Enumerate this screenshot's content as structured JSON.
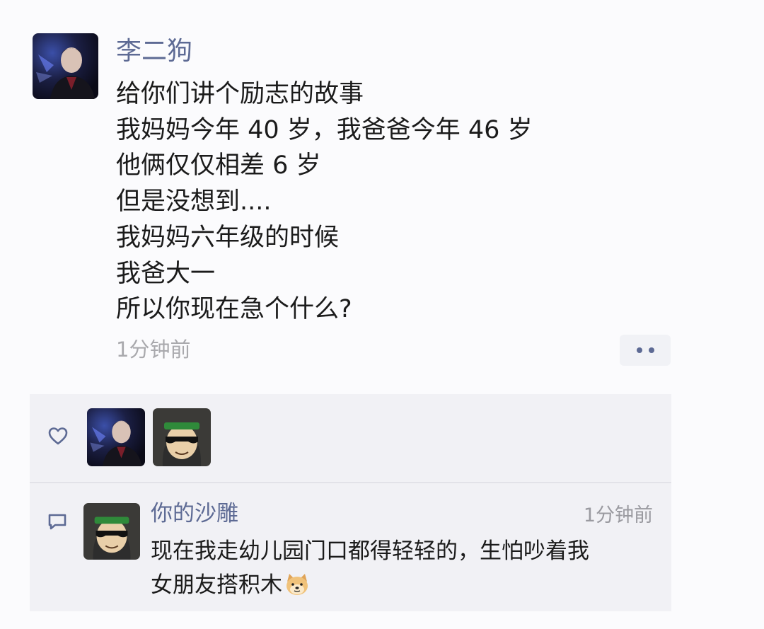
{
  "post": {
    "author": "李二狗",
    "lines": [
      "给你们讲个励志的故事",
      "我妈妈今年 40 岁，我爸爸今年 46 岁",
      "他俩仅仅相差 6 岁",
      "但是没想到....",
      "我妈妈六年级的时候",
      "我爸大一",
      "所以你现在急个什么?"
    ],
    "time": "1分钟前"
  },
  "likes": {
    "icon": "heart-icon",
    "avatars": [
      "avatar-dark-portrait",
      "avatar-cartoon-sunglasses"
    ]
  },
  "comment": {
    "icon": "comment-icon",
    "author": "你的沙雕",
    "time": "1分钟前",
    "text_line1": "现在我走幼儿园门口都得轻轻的，生怕吵着我",
    "text_line2": "女朋友搭积木",
    "emoji": "doge-emoji"
  },
  "colors": {
    "name": "#5d6a94",
    "text": "#1b1b1b",
    "muted": "#a9a9ad",
    "panel": "#f1f1f5"
  }
}
